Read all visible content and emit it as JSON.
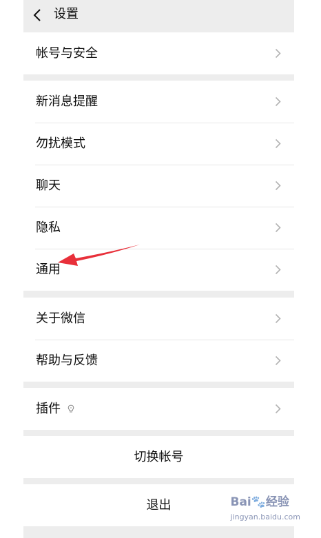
{
  "header": {
    "title": "设置",
    "back_icon": "chevron-left-icon"
  },
  "group1": {
    "items": [
      {
        "label": "帐号与安全"
      }
    ]
  },
  "group2": {
    "items": [
      {
        "label": "新消息提醒"
      },
      {
        "label": "勿扰模式"
      },
      {
        "label": "聊天"
      },
      {
        "label": "隐私"
      },
      {
        "label": "通用"
      }
    ]
  },
  "group3": {
    "items": [
      {
        "label": "关于微信"
      },
      {
        "label": "帮助与反馈"
      }
    ]
  },
  "group4": {
    "items": [
      {
        "label": "插件",
        "icon": "lightbulb-icon"
      }
    ]
  },
  "switch_account": {
    "label": "切换帐号"
  },
  "logout": {
    "label": "退出"
  },
  "annotation": {
    "color": "#e8303a"
  },
  "watermark": {
    "brand": "Bai",
    "paw": "🐾",
    "suffix": "经验",
    "sub": "jingyan.baidu.com"
  }
}
